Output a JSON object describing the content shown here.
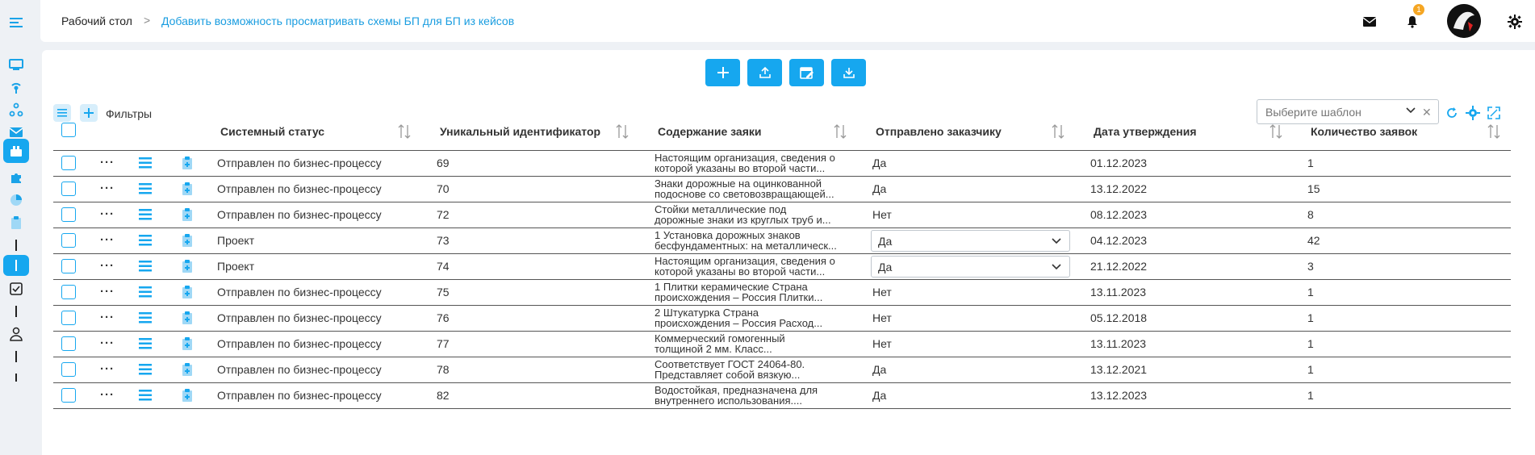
{
  "header": {
    "breadcrumb_root": "Рабочий стол",
    "breadcrumb_separator": ">",
    "breadcrumb_current": "Добавить возможность просматривать схемы БП для БП из кейсов",
    "notification_count": "1"
  },
  "toolbar": {
    "filters_label": "Фильтры",
    "template_placeholder": "Выберите шаблон",
    "template_clear": "✕"
  },
  "table": {
    "columns": [
      "Системный статус",
      "Уникальный идентификатор",
      "Содержание заяки",
      "Отправлено заказчику",
      "Дата утверждения",
      "Количество заявок"
    ],
    "rows": [
      {
        "status": "Отправлен по бизнес-процессу",
        "id": "69",
        "content1": "Настоящим организация, сведения о",
        "content2": "которой указаны во второй части...",
        "sent": "Да",
        "date": "01.12.2023",
        "count": "1"
      },
      {
        "status": "Отправлен по бизнес-процессу",
        "id": "70",
        "content1": "Знаки дорожные на оцинкованной",
        "content2": "подоснове со световозвращающей...",
        "sent": "Да",
        "date": "13.12.2022",
        "count": "15"
      },
      {
        "status": "Отправлен по бизнес-процессу",
        "id": "72",
        "content1": "Стойки металлические под",
        "content2": "дорожные знаки из круглых труб и...",
        "sent": "Нет",
        "date": "08.12.2023",
        "count": "8"
      },
      {
        "status": "Проект",
        "id": "73",
        "content1": "1 Установка дорожных знаков",
        "content2": "бесфундаментных: на металличеcк...",
        "sent": "Да",
        "date": "04.12.2023",
        "count": "42"
      },
      {
        "status": "Проект",
        "id": "74",
        "content1": "Настоящим организация, сведения о",
        "content2": "которой указаны во второй части...",
        "sent": "Да",
        "date": "21.12.2022",
        "count": "3"
      },
      {
        "status": "Отправлен по бизнес-процессу",
        "id": "75",
        "content1": "1 Плитки керамические Страна",
        "content2": "происхождения – Россия Плитки...",
        "sent": "Нет",
        "date": "13.11.2023",
        "count": "1"
      },
      {
        "status": "Отправлен по бизнес-процессу",
        "id": "76",
        "content1": "2 Штукатурка Страна",
        "content2": "происхождения – Россия Расход...",
        "sent": "Нет",
        "date": "05.12.2018",
        "count": "1"
      },
      {
        "status": "Отправлен по бизнес-процессу",
        "id": "77",
        "content1": "Коммерческий гомогенный",
        "content2": "толщиной 2 мм. Класс...",
        "sent": "Нет",
        "date": "13.11.2023",
        "count": "1"
      },
      {
        "status": "Отправлен по бизнес-процессу",
        "id": "78",
        "content1": "Соответствует ГОСТ 24064-80.",
        "content2": "Представляет собой вязкую...",
        "sent": "Да",
        "date": "13.12.2021",
        "count": "1"
      },
      {
        "status": "Отправлен по бизнес-процессу",
        "id": "82",
        "content1": "Водостойкая, предназначена для",
        "content2": "внутреннего использования....",
        "sent": "Да",
        "date": "13.12.2023",
        "count": "1"
      }
    ],
    "row_menu": "···"
  },
  "colors": {
    "accent": "#16a7ef",
    "link": "#1a9de0",
    "badge": "#f5a623"
  }
}
